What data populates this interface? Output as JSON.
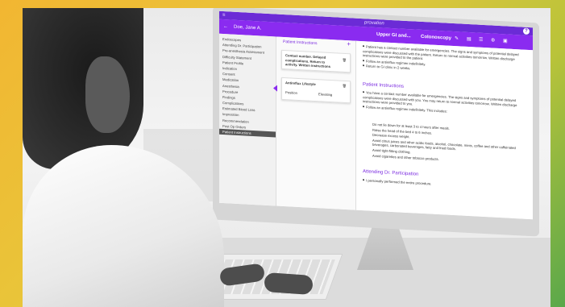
{
  "app": {
    "brand": "provation"
  },
  "patient": {
    "name": "Doe, Jane A."
  },
  "procedure": {
    "title": "Upper GI and...",
    "subtitle": "Colonoscopy"
  },
  "sidebar": {
    "items": [
      {
        "label": "Endoscopes"
      },
      {
        "label": "Attending Dr. Participation"
      },
      {
        "label": "Pre-anesthesia Assessment"
      },
      {
        "label": "Difficulty Statement"
      },
      {
        "label": "Patient Profile"
      },
      {
        "label": "Indication"
      },
      {
        "label": "Consent"
      },
      {
        "label": "Medication"
      },
      {
        "label": "Anesthesia"
      },
      {
        "label": "Procedure"
      },
      {
        "label": "Findings"
      },
      {
        "label": "Complications"
      },
      {
        "label": "Estimated Blood Loss"
      },
      {
        "label": "Impression"
      },
      {
        "label": "Recommendation"
      },
      {
        "label": "Post Op Orders"
      },
      {
        "label": "Patient Instructions",
        "active": true
      }
    ]
  },
  "middle": {
    "header": "Patient Instructions",
    "add_icon": "+",
    "card1": "Contact number. Delayed complications. Return to activity. Written instructions",
    "card2_title": "Antireflux Lifestyle",
    "card2_a": "Position",
    "card2_b": "Elevating"
  },
  "main": {
    "intro_bullets": [
      "Patient has a contact number available for emergencies. The signs and symptoms of potential delayed complications were discussed with the patient. Return to normal activities tomorrow. Written discharge instructions were provided to the patient.",
      "Follow an antireflux regimen indefinitely.",
      "Return to GI clinic in 2 weeks."
    ],
    "section1_title": "Patient Instructions",
    "section1_bullets": [
      "You have a contact number available for emergencies. The signs and symptoms of potential delayed complications were discussed with you. You may return to normal activities tomorrow. Written discharge instructions were provided to you.",
      "Follow an antireflux regimen indefinitely. This includes:"
    ],
    "regimen": [
      "Do not lie down for at least 3 to 4 hours after meals.",
      "Raise the head of the bed 4 to 6 inches.",
      "Decrease excess weight.",
      "Avoid citrus juices and other acidic foods, alcohol, chocolate, mints, coffee and other caffeinated beverages, carbonated beverages, fatty and fried foods.",
      "Avoid tight-fitting clothing.",
      "Avoid cigarettes and other tobacco products."
    ],
    "section2_title": "Attending Dr. Participation",
    "section2_bullets": [
      "I personally performed the entire procedure."
    ]
  },
  "colors": {
    "frame_top": "#f2b632",
    "frame_bottom": "#5aa84a",
    "accent": "#8a2bf0"
  }
}
